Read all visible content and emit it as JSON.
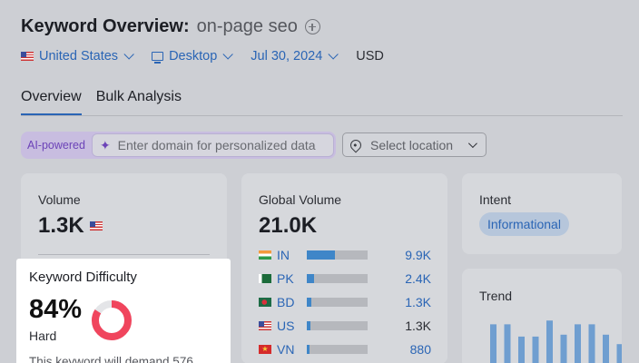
{
  "header": {
    "title": "Keyword Overview:",
    "keyword": "on-page seo"
  },
  "filters": {
    "country": "United States",
    "device": "Desktop",
    "date": "Jul 30, 2024",
    "currency": "USD"
  },
  "tabs": [
    {
      "label": "Overview",
      "active": true
    },
    {
      "label": "Bulk Analysis",
      "active": false
    }
  ],
  "ai": {
    "label": "AI-powered",
    "placeholder": "Enter domain for personalized data"
  },
  "location": {
    "placeholder": "Select location"
  },
  "volume": {
    "label": "Volume",
    "value": "1.3K"
  },
  "global_volume": {
    "label": "Global Volume",
    "value": "21.0K",
    "countries": [
      {
        "code": "IN",
        "value": "9.9K",
        "share": 0.47,
        "link": true
      },
      {
        "code": "PK",
        "value": "2.4K",
        "share": 0.12,
        "link": true
      },
      {
        "code": "BD",
        "value": "1.3K",
        "share": 0.07,
        "link": true
      },
      {
        "code": "US",
        "value": "1.3K",
        "share": 0.06,
        "link": false
      },
      {
        "code": "VN",
        "value": "880",
        "share": 0.05,
        "link": true
      }
    ]
  },
  "intent": {
    "label": "Intent",
    "badge": "Informational"
  },
  "trend": {
    "label": "Trend",
    "bars": [
      0.82,
      0.82,
      0.56,
      0.56,
      0.9,
      0.6,
      0.82,
      0.82,
      0.6,
      0.4
    ]
  },
  "keyword_difficulty": {
    "label": "Keyword Difficulty",
    "value": "84%",
    "percent": 84,
    "level": "Hard",
    "description": "This keyword will demand 576"
  },
  "colors": {
    "accent": "#2a65b5",
    "kd_hard": "#f0455d",
    "bar": "#3f86c8"
  }
}
